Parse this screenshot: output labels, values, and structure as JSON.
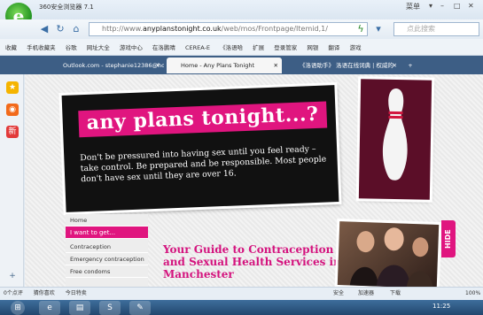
{
  "window": {
    "title": "360安全浏览器 7.1",
    "menu_label": "菜单",
    "controls": [
      "▾",
      "–",
      "□",
      "✕"
    ]
  },
  "nav": {
    "url_prefix": "http://www.",
    "url_host": "anyplanstonight.co.uk",
    "url_path": "/web/mos/Frontpage/Itemid,1/",
    "search_placeholder": "点此搜索"
  },
  "bookmarks": [
    "收藏",
    "手机收藏夹",
    "谷歌",
    "网址大全",
    "游戏中心",
    "在洛鹏晴",
    "CEREA-E",
    "《洛语哈",
    "扩展",
    "登录管家",
    "网银",
    "翻译",
    "游戏"
  ],
  "tabs": [
    {
      "label": "Outlook.com - stephanie12386@ho",
      "active": false
    },
    {
      "label": "Home - Any Plans Tonight",
      "active": true
    },
    {
      "label": "《洛语助手》 洛语在线词典 | 权威的",
      "active": false
    }
  ],
  "page": {
    "hero_title": "any plans tonight...?",
    "hero_body": "Don't be pressured into having sex until you feel ready – take control. Be prepared and be responsible. Most people don't have sex until they are over 16.",
    "menu": [
      "Home",
      "I want to get...",
      "Contraception",
      "Emergency contraception",
      "Free condoms"
    ],
    "guide_heading": "Your Guide to Contraception and Sexual Health Services in Manchester",
    "hide_tab": "HIDE"
  },
  "status": {
    "left": [
      "0个点评",
      "猜你喜欢",
      "今日特卖"
    ],
    "right": [
      "安全",
      "加速器",
      "下载",
      "100%"
    ]
  },
  "taskbar": {
    "time": "11:25"
  },
  "colors": {
    "brand_pink": "#e0157f",
    "hero_bg": "#111111"
  }
}
